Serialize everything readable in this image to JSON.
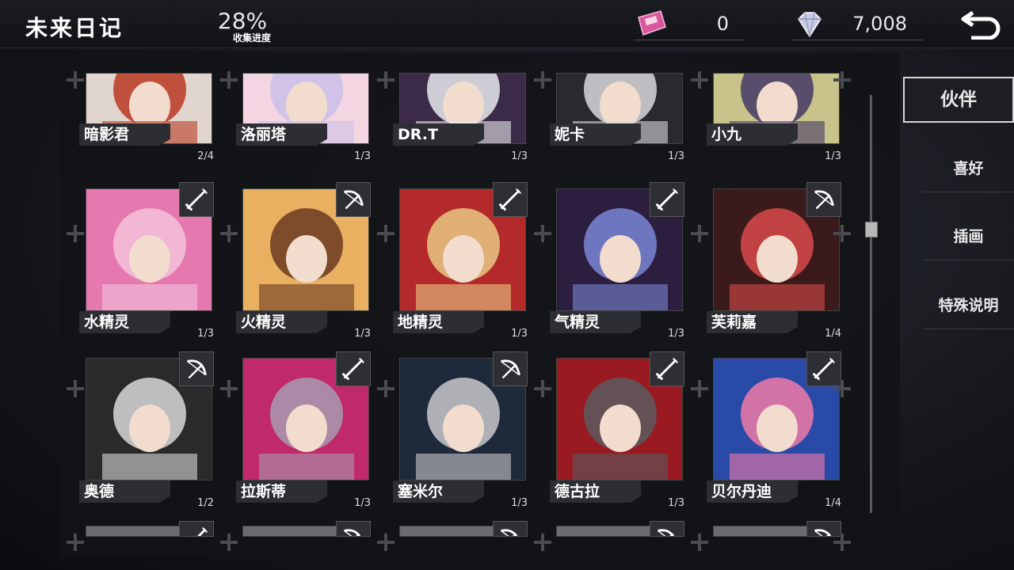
{
  "header": {
    "title": "未来日记",
    "progress_value": "28%",
    "progress_label": "收集进度",
    "ticket_count": "0",
    "diamond_count": "7,008"
  },
  "side_tabs": [
    {
      "label": "伙伴",
      "active": true
    },
    {
      "label": "喜好",
      "active": false
    },
    {
      "label": "插画",
      "active": false
    },
    {
      "label": "特殊说明",
      "active": false
    }
  ],
  "characters": [
    {
      "name": "暗影君",
      "count": "2/4",
      "weapon": null,
      "palette": [
        "#b83a22",
        "#e0d6cf"
      ]
    },
    {
      "name": "洛丽塔",
      "count": "1/3",
      "weapon": null,
      "palette": [
        "#c9c0e8",
        "#f4d6e2"
      ]
    },
    {
      "name": "DR.T",
      "count": "1/3",
      "weapon": null,
      "palette": [
        "#e9e9ee",
        "#3b2a48"
      ]
    },
    {
      "name": "妮卡",
      "count": "1/3",
      "weapon": null,
      "palette": [
        "#d8d8dc",
        "#2a2a2e"
      ]
    },
    {
      "name": "小九",
      "count": "1/3",
      "weapon": null,
      "palette": [
        "#443a66",
        "#c8c38a"
      ]
    },
    {
      "name": "水精灵",
      "count": "1/3",
      "weapon": "sword-icon",
      "palette": [
        "#f2c2dc",
        "#e678b0"
      ]
    },
    {
      "name": "火精灵",
      "count": "1/3",
      "weapon": "bow-icon",
      "palette": [
        "#6b3a22",
        "#e8b060"
      ]
    },
    {
      "name": "地精灵",
      "count": "1/3",
      "weapon": "sword-icon",
      "palette": [
        "#e8c784",
        "#b42a2a"
      ]
    },
    {
      "name": "气精灵",
      "count": "1/3",
      "weapon": "sword-icon",
      "palette": [
        "#7a86d6",
        "#2c1e3e"
      ]
    },
    {
      "name": "芙莉嘉",
      "count": "1/4",
      "weapon": "bow-icon",
      "palette": [
        "#d84a4a",
        "#3a1a1a"
      ]
    },
    {
      "name": "奥德",
      "count": "1/2",
      "weapon": "bow-icon",
      "palette": [
        "#d8d8d8",
        "#2a2a2a"
      ]
    },
    {
      "name": "拉斯蒂",
      "count": "1/3",
      "weapon": "sword-icon",
      "palette": [
        "#a89ab0",
        "#c02a6a"
      ]
    },
    {
      "name": "塞米尔",
      "count": "1/3",
      "weapon": "bow-icon",
      "palette": [
        "#c8c8cc",
        "#1e2a3a"
      ]
    },
    {
      "name": "德古拉",
      "count": "1/3",
      "weapon": "sword-icon",
      "palette": [
        "#5a5a5e",
        "#9a1a22"
      ]
    },
    {
      "name": "贝尔丹迪",
      "count": "1/4",
      "weapon": "sword-icon",
      "palette": [
        "#f07aa8",
        "#2a4aa8"
      ]
    }
  ],
  "partial_row_weapons": [
    "sword-icon",
    "bow-icon",
    "bow-icon",
    "bow-icon",
    "bow-icon"
  ]
}
